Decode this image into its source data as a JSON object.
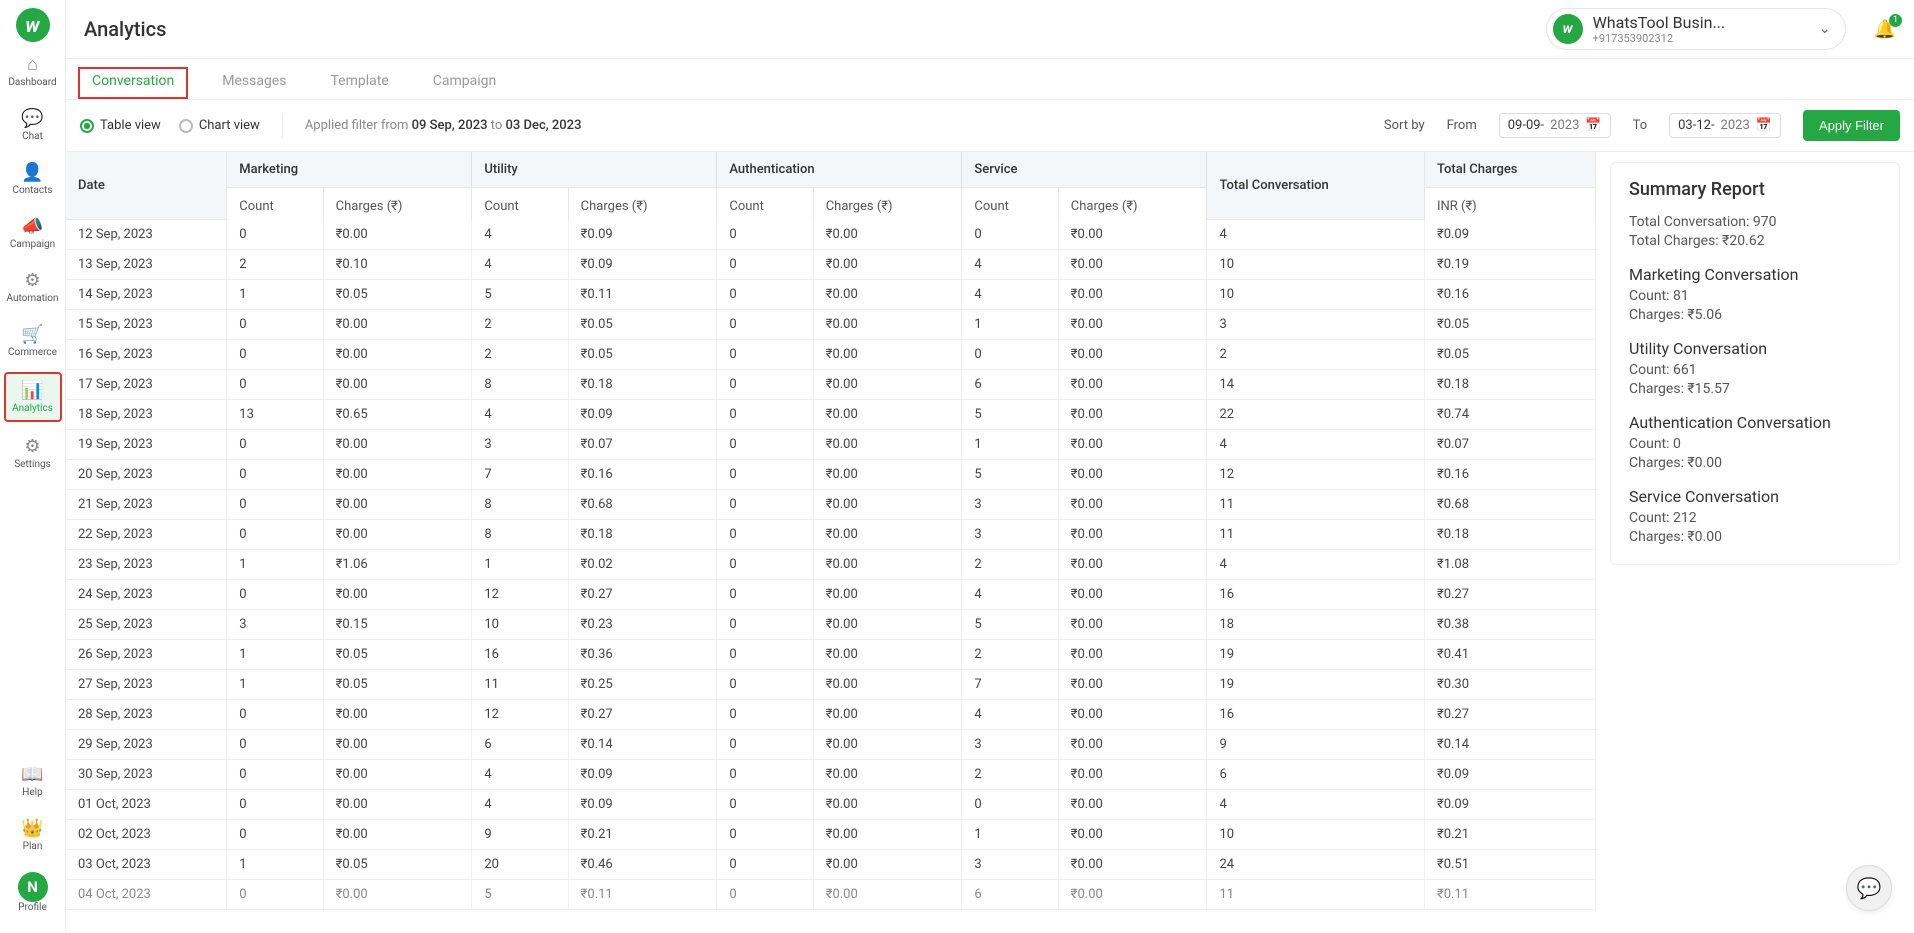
{
  "sidebar": {
    "items": [
      {
        "label": "Dashboard",
        "icon": "⌂"
      },
      {
        "label": "Chat",
        "icon": "💬"
      },
      {
        "label": "Contacts",
        "icon": "👤"
      },
      {
        "label": "Campaign",
        "icon": "📣"
      },
      {
        "label": "Automation",
        "icon": "⚙"
      },
      {
        "label": "Commerce",
        "icon": "🛒"
      },
      {
        "label": "Analytics",
        "icon": "📊"
      },
      {
        "label": "Settings",
        "icon": "⚙"
      }
    ],
    "help_label": "Help",
    "plan_label": "Plan",
    "profile_label": "Profile",
    "profile_letter": "N"
  },
  "header": {
    "title": "Analytics",
    "account_name": "WhatsTool Busin...",
    "account_phone": "+917353902312",
    "avatar_letter": "w",
    "notif_count": "1"
  },
  "tabs": [
    {
      "label": "Conversation",
      "active": true
    },
    {
      "label": "Messages"
    },
    {
      "label": "Template"
    },
    {
      "label": "Campaign"
    }
  ],
  "view": {
    "table_label": "Table view",
    "chart_label": "Chart view",
    "applied_prefix": "Applied filter from ",
    "applied_from": "09 Sep, 2023",
    "applied_mid": " to ",
    "applied_to": "03 Dec, 2023",
    "sort_by": "Sort by",
    "from_label": "From",
    "to_label": "To",
    "date_from_day": "09-09-",
    "date_from_year": "2023",
    "date_to_day": "03-12-",
    "date_to_year": "2023",
    "apply_label": "Apply Filter"
  },
  "columns": {
    "date": "Date",
    "marketing": "Marketing",
    "utility": "Utility",
    "authentication": "Authentication",
    "service": "Service",
    "total_conv": "Total Conversation",
    "total_charges": "Total Charges",
    "count": "Count",
    "charges": "Charges (₹)",
    "inr": "INR (₹)"
  },
  "rows": [
    {
      "date": "12 Sep, 2023",
      "mc": "0",
      "mch": "₹0.00",
      "uc": "4",
      "uch": "₹0.09",
      "ac": "0",
      "ach": "₹0.00",
      "sc": "0",
      "sch": "₹0.00",
      "tc": "4",
      "tch": "₹0.09"
    },
    {
      "date": "13 Sep, 2023",
      "mc": "2",
      "mch": "₹0.10",
      "uc": "4",
      "uch": "₹0.09",
      "ac": "0",
      "ach": "₹0.00",
      "sc": "4",
      "sch": "₹0.00",
      "tc": "10",
      "tch": "₹0.19"
    },
    {
      "date": "14 Sep, 2023",
      "mc": "1",
      "mch": "₹0.05",
      "uc": "5",
      "uch": "₹0.11",
      "ac": "0",
      "ach": "₹0.00",
      "sc": "4",
      "sch": "₹0.00",
      "tc": "10",
      "tch": "₹0.16"
    },
    {
      "date": "15 Sep, 2023",
      "mc": "0",
      "mch": "₹0.00",
      "uc": "2",
      "uch": "₹0.05",
      "ac": "0",
      "ach": "₹0.00",
      "sc": "1",
      "sch": "₹0.00",
      "tc": "3",
      "tch": "₹0.05"
    },
    {
      "date": "16 Sep, 2023",
      "mc": "0",
      "mch": "₹0.00",
      "uc": "2",
      "uch": "₹0.05",
      "ac": "0",
      "ach": "₹0.00",
      "sc": "0",
      "sch": "₹0.00",
      "tc": "2",
      "tch": "₹0.05"
    },
    {
      "date": "17 Sep, 2023",
      "mc": "0",
      "mch": "₹0.00",
      "uc": "8",
      "uch": "₹0.18",
      "ac": "0",
      "ach": "₹0.00",
      "sc": "6",
      "sch": "₹0.00",
      "tc": "14",
      "tch": "₹0.18"
    },
    {
      "date": "18 Sep, 2023",
      "mc": "13",
      "mch": "₹0.65",
      "uc": "4",
      "uch": "₹0.09",
      "ac": "0",
      "ach": "₹0.00",
      "sc": "5",
      "sch": "₹0.00",
      "tc": "22",
      "tch": "₹0.74"
    },
    {
      "date": "19 Sep, 2023",
      "mc": "0",
      "mch": "₹0.00",
      "uc": "3",
      "uch": "₹0.07",
      "ac": "0",
      "ach": "₹0.00",
      "sc": "1",
      "sch": "₹0.00",
      "tc": "4",
      "tch": "₹0.07"
    },
    {
      "date": "20 Sep, 2023",
      "mc": "0",
      "mch": "₹0.00",
      "uc": "7",
      "uch": "₹0.16",
      "ac": "0",
      "ach": "₹0.00",
      "sc": "5",
      "sch": "₹0.00",
      "tc": "12",
      "tch": "₹0.16"
    },
    {
      "date": "21 Sep, 2023",
      "mc": "0",
      "mch": "₹0.00",
      "uc": "8",
      "uch": "₹0.68",
      "ac": "0",
      "ach": "₹0.00",
      "sc": "3",
      "sch": "₹0.00",
      "tc": "11",
      "tch": "₹0.68"
    },
    {
      "date": "22 Sep, 2023",
      "mc": "0",
      "mch": "₹0.00",
      "uc": "8",
      "uch": "₹0.18",
      "ac": "0",
      "ach": "₹0.00",
      "sc": "3",
      "sch": "₹0.00",
      "tc": "11",
      "tch": "₹0.18"
    },
    {
      "date": "23 Sep, 2023",
      "mc": "1",
      "mch": "₹1.06",
      "uc": "1",
      "uch": "₹0.02",
      "ac": "0",
      "ach": "₹0.00",
      "sc": "2",
      "sch": "₹0.00",
      "tc": "4",
      "tch": "₹1.08"
    },
    {
      "date": "24 Sep, 2023",
      "mc": "0",
      "mch": "₹0.00",
      "uc": "12",
      "uch": "₹0.27",
      "ac": "0",
      "ach": "₹0.00",
      "sc": "4",
      "sch": "₹0.00",
      "tc": "16",
      "tch": "₹0.27"
    },
    {
      "date": "25 Sep, 2023",
      "mc": "3",
      "mch": "₹0.15",
      "uc": "10",
      "uch": "₹0.23",
      "ac": "0",
      "ach": "₹0.00",
      "sc": "5",
      "sch": "₹0.00",
      "tc": "18",
      "tch": "₹0.38"
    },
    {
      "date": "26 Sep, 2023",
      "mc": "1",
      "mch": "₹0.05",
      "uc": "16",
      "uch": "₹0.36",
      "ac": "0",
      "ach": "₹0.00",
      "sc": "2",
      "sch": "₹0.00",
      "tc": "19",
      "tch": "₹0.41"
    },
    {
      "date": "27 Sep, 2023",
      "mc": "1",
      "mch": "₹0.05",
      "uc": "11",
      "uch": "₹0.25",
      "ac": "0",
      "ach": "₹0.00",
      "sc": "7",
      "sch": "₹0.00",
      "tc": "19",
      "tch": "₹0.30"
    },
    {
      "date": "28 Sep, 2023",
      "mc": "0",
      "mch": "₹0.00",
      "uc": "12",
      "uch": "₹0.27",
      "ac": "0",
      "ach": "₹0.00",
      "sc": "4",
      "sch": "₹0.00",
      "tc": "16",
      "tch": "₹0.27"
    },
    {
      "date": "29 Sep, 2023",
      "mc": "0",
      "mch": "₹0.00",
      "uc": "6",
      "uch": "₹0.14",
      "ac": "0",
      "ach": "₹0.00",
      "sc": "3",
      "sch": "₹0.00",
      "tc": "9",
      "tch": "₹0.14"
    },
    {
      "date": "30 Sep, 2023",
      "mc": "0",
      "mch": "₹0.00",
      "uc": "4",
      "uch": "₹0.09",
      "ac": "0",
      "ach": "₹0.00",
      "sc": "2",
      "sch": "₹0.00",
      "tc": "6",
      "tch": "₹0.09"
    },
    {
      "date": "01 Oct, 2023",
      "mc": "0",
      "mch": "₹0.00",
      "uc": "4",
      "uch": "₹0.09",
      "ac": "0",
      "ach": "₹0.00",
      "sc": "0",
      "sch": "₹0.00",
      "tc": "4",
      "tch": "₹0.09"
    },
    {
      "date": "02 Oct, 2023",
      "mc": "0",
      "mch": "₹0.00",
      "uc": "9",
      "uch": "₹0.21",
      "ac": "0",
      "ach": "₹0.00",
      "sc": "1",
      "sch": "₹0.00",
      "tc": "10",
      "tch": "₹0.21"
    },
    {
      "date": "03 Oct, 2023",
      "mc": "1",
      "mch": "₹0.05",
      "uc": "20",
      "uch": "₹0.46",
      "ac": "0",
      "ach": "₹0.00",
      "sc": "3",
      "sch": "₹0.00",
      "tc": "24",
      "tch": "₹0.51"
    },
    {
      "date": "04 Oct, 2023",
      "mc": "0",
      "mch": "₹0.00",
      "uc": "5",
      "uch": "₹0.11",
      "ac": "0",
      "ach": "₹0.00",
      "sc": "6",
      "sch": "₹0.00",
      "tc": "11",
      "tch": "₹0.11"
    }
  ],
  "summary": {
    "title": "Summary Report",
    "total_conv": "Total Conversation: 970",
    "total_charges": "Total Charges: ₹20.62",
    "m_title": "Marketing Conversation",
    "m_count": "Count: 81",
    "m_charges": "Charges: ₹5.06",
    "u_title": "Utility Conversation",
    "u_count": "Count: 661",
    "u_charges": "Charges: ₹15.57",
    "a_title": "Authentication Conversation",
    "a_count": "Count: 0",
    "a_charges": "Charges: ₹0.00",
    "s_title": "Service Conversation",
    "s_count": "Count: 212",
    "s_charges": "Charges: ₹0.00"
  }
}
